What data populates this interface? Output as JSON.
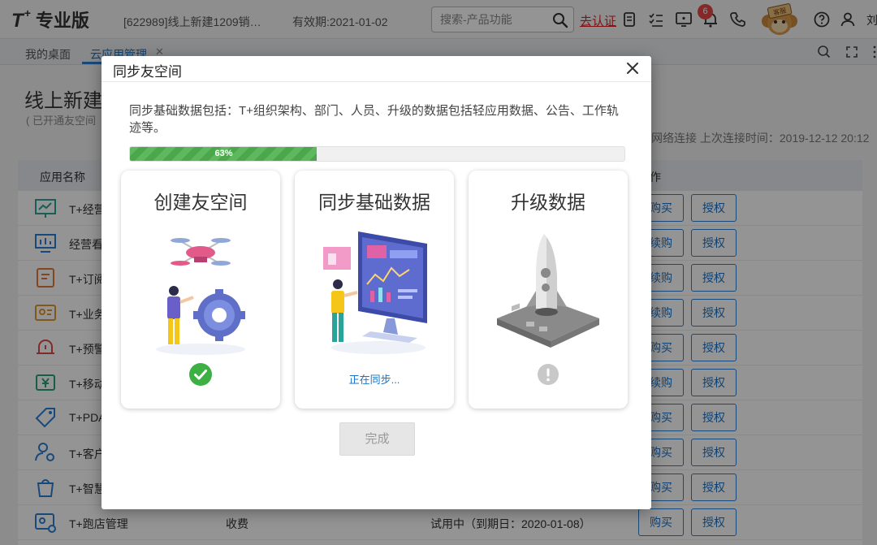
{
  "header": {
    "logo_main": "T",
    "logo_sup": "+",
    "logo_edition": "专业版",
    "company": "[622989]线上新建1209销…",
    "expiry": "有效期:2021-01-02",
    "search_placeholder": "搜索-产品功能",
    "auth_link": "去认证",
    "notification_count": "6",
    "user": "刘"
  },
  "tabs": [
    {
      "label": "我的桌面"
    },
    {
      "label": "云应用管理"
    }
  ],
  "page": {
    "title": "线上新建",
    "subtitle": "( 已开通友空间",
    "connection": "网络连接",
    "last_connected": "上次连接时间：2019-12-12 20:12",
    "col_name": "应用名称",
    "col_action": "作"
  },
  "apps": [
    {
      "name": "T+经营",
      "btn1": "购买",
      "btn2": "授权"
    },
    {
      "name": "经营看",
      "btn1": "续购",
      "btn2": "授权"
    },
    {
      "name": "T+订阅",
      "btn1": "续购",
      "btn2": "授权"
    },
    {
      "name": "T+业务",
      "btn1": "续购",
      "btn2": "授权"
    },
    {
      "name": "T+预警",
      "btn1": "购买",
      "btn2": "授权"
    },
    {
      "name": "T+移动",
      "btn1": "续购",
      "btn2": "授权"
    },
    {
      "name": "T+PDA",
      "btn1": "购买",
      "btn2": "授权"
    },
    {
      "name": "T+客户",
      "btn1": "购买",
      "btn2": "授权"
    },
    {
      "name": "T+智慧",
      "btn1": "购买",
      "btn2": "授权"
    },
    {
      "name": "T+跑店管理",
      "fee": "收费",
      "status": "试用中（到期日：2020-01-08）",
      "btn1": "购买",
      "btn2": "授权"
    }
  ],
  "dialog": {
    "title": "同步友空间",
    "description": "同步基础数据包括：T+组织架构、部门、人员、升级的数据包括轻应用数据、公告、工作轨迹等。",
    "progress_label": "63%",
    "progress_value": 0.63,
    "steps": [
      {
        "title": "创建友空间",
        "state": "done"
      },
      {
        "title": "同步基础数据",
        "state": "in-progress",
        "status_text": "正在同步..."
      },
      {
        "title": "升级数据",
        "state": "pending"
      }
    ],
    "done_button": "完成"
  },
  "colors": {
    "accent": "#2a7fd4",
    "success": "#3cb043",
    "progress": "#5fb85f",
    "danger": "#e02020"
  }
}
